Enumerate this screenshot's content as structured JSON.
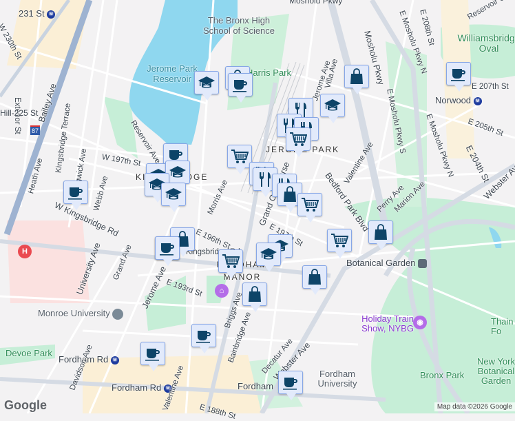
{
  "map": {
    "labels": {
      "st231": "231 St",
      "w230": "W 230th St",
      "exterior": "Exterior St",
      "bailey": "Bailey Ave",
      "hill225": "Hill-225 St",
      "i87": "87",
      "reservoir": "Jerome Park Reservoir",
      "bronx_sci": "The Bronx High School of Science",
      "harris": "Harris Park",
      "reservoir_ave": "Reservoir Ave",
      "w197": "W 197th St",
      "kingsbridge_terrace": "Kingsbridge Terrace",
      "sedgwick": "Sedgwick Ave",
      "heath": "Heath Ave",
      "webb": "Webb Ave",
      "kingsbridge_heights": "KINGSBRIDGE",
      "kingsbridge_rd": "W Kingsbridge Rd",
      "university": "University Ave",
      "grand": "Grand Ave",
      "jerome": "Jerome Ave",
      "e193": "E 193rd St",
      "monroe": "Monroe University",
      "devoe": "Devoe Park",
      "fordham_rd": "Fordham Rd",
      "fordham_rd_station": "Fordham Rd",
      "fordham_station2": "Fordham",
      "morris": "Morris Ave",
      "e196": "E 196th St",
      "kingsbridge_rd_e": "Kingsbridge Rd",
      "fordham_manor": "FORDHAM MANOR",
      "briggs": "Briggs Ave",
      "bainbridge": "Bainbridge Ave",
      "valentine_ave2": "Valentine Ave",
      "e188": "E 188th St",
      "mosholu_pkwy": "Mosholu Pkwy",
      "e_mosholu_n": "E Mosholu Pkwy N",
      "e_mosholu_s": "E Mosholu Pkwy S",
      "e208": "E 208th St",
      "villa": "Villa Ave",
      "jerome2": "Jerome Ave",
      "grand_concourse": "Grand Concourse",
      "jerome_park": "JEROME PARK",
      "valentine": "Valentine Ave",
      "bedford_park": "Bedford Park Blvd",
      "williamsbridge": "Williamsbridge Oval",
      "reservoir_oval": "Reservoir Oval E",
      "e207": "E 207th St",
      "norwood": "Norwood",
      "e205": "E 205th St",
      "e204": "E 204th St",
      "webster": "Webster Ave",
      "perry": "Perry Ave",
      "marion": "Marion Ave",
      "e197": "E 197th St",
      "botanical_garden": "Botanical Garden",
      "holiday": "Holiday Train Show, NYBG",
      "decatur": "Decatur Ave",
      "webster2": "Webster Ave",
      "fordham_univ": "Fordham University",
      "bronx_park": "Bronx Park",
      "nybg": "New York Botanical Garden",
      "thain": "Thain Fo",
      "mosholu_top": "Mosholu Pkwy",
      "davidson": "Davidson Ave"
    },
    "hospital_letter": "H",
    "subway_badge": "M",
    "google_logo": "Google",
    "attribution": "Map data ©2026 Google",
    "colors": {
      "water": "#8fd7ef",
      "park": "#c3eed6",
      "marker_bg": "#e2eafb",
      "marker_icon": "#0d4468",
      "hospital": "#ea4a50"
    }
  },
  "markers": [
    {
      "type": "school"
    },
    {
      "type": "shopping"
    },
    {
      "type": "cafe"
    },
    {
      "type": "shopping"
    },
    {
      "type": "cafe"
    },
    {
      "type": "school"
    },
    {
      "type": "restaurant"
    },
    {
      "type": "restaurant"
    },
    {
      "type": "restaurant"
    },
    {
      "type": "grocery"
    },
    {
      "type": "cafe"
    },
    {
      "type": "school"
    },
    {
      "type": "school"
    },
    {
      "type": "school"
    },
    {
      "type": "school"
    },
    {
      "type": "cafe"
    },
    {
      "type": "grocery"
    },
    {
      "type": "restaurant"
    },
    {
      "type": "restaurant"
    },
    {
      "type": "restaurant"
    },
    {
      "type": "shopping"
    },
    {
      "type": "grocery"
    },
    {
      "type": "school"
    },
    {
      "type": "school"
    },
    {
      "type": "grocery"
    },
    {
      "type": "shopping"
    },
    {
      "type": "cafe"
    },
    {
      "type": "shopping"
    },
    {
      "type": "cafe"
    },
    {
      "type": "grocery"
    },
    {
      "type": "shopping"
    },
    {
      "type": "shopping"
    },
    {
      "type": "cafe"
    },
    {
      "type": "cafe"
    },
    {
      "type": "cafe"
    }
  ]
}
